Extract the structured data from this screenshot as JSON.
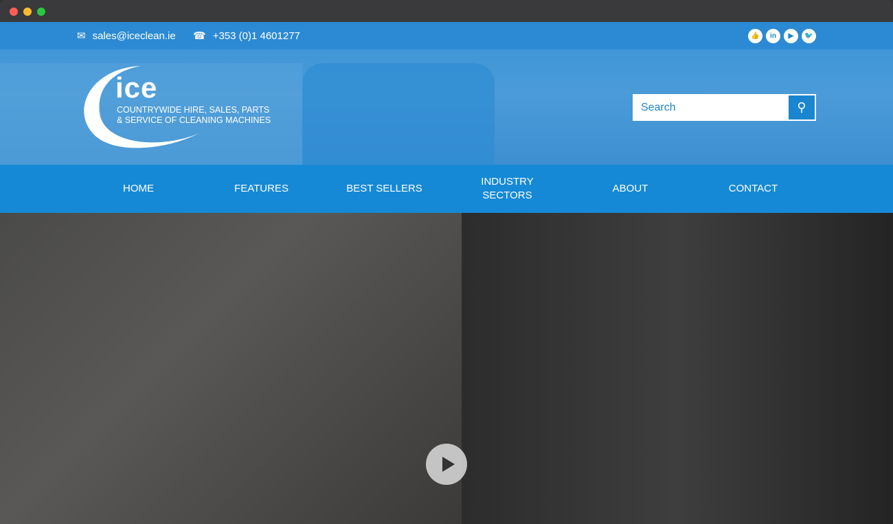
{
  "contact": {
    "email": "sales@iceclean.ie",
    "phone": "+353 (0)1 4601277"
  },
  "social": [
    {
      "icon": "thumbs-up-icon",
      "label": "👍"
    },
    {
      "icon": "linkedin-icon",
      "label": "in"
    },
    {
      "icon": "youtube-icon",
      "label": "▶"
    },
    {
      "icon": "twitter-icon",
      "label": "🐦"
    }
  ],
  "logo": {
    "name": "ice",
    "tagline1": "COUNTRYWIDE HIRE, SALES, PARTS",
    "tagline2": "& SERVICE OF CLEANING MACHINES"
  },
  "search": {
    "placeholder": "Search"
  },
  "nav": [
    "HOME",
    "FEATURES",
    "BEST SELLERS",
    "INDUSTRY SECTORS",
    "ABOUT",
    "CONTACT"
  ],
  "colors": {
    "brand": "#1689d6"
  }
}
